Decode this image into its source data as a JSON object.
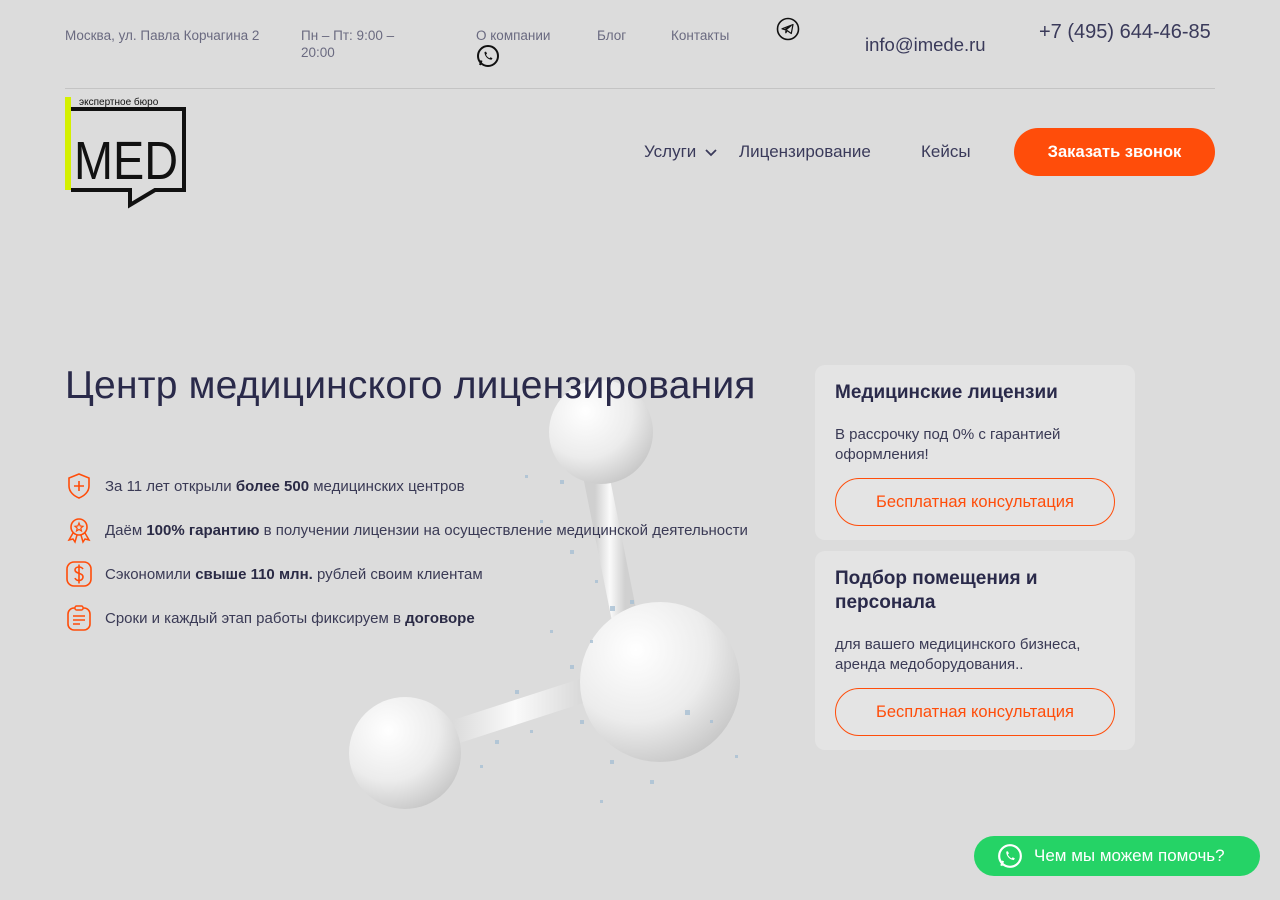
{
  "topbar": {
    "address": "Москва, ул. Павла Корчагина 2",
    "hours": "Пн – Пт: 9:00 – 20:00",
    "links": [
      "О компании",
      "Блог",
      "Контакты"
    ],
    "email": "info@imede.ru",
    "phone": "+7 (495) 644-46-85",
    "icons": [
      "whatsapp-icon",
      "telegram-icon"
    ]
  },
  "logo": {
    "tagline": "экспертное бюро",
    "name": "MED",
    "accent": "#d4f000"
  },
  "nav": {
    "services": "Услуги",
    "licensing": "Лицензирование",
    "cases": "Кейсы",
    "cta": "Заказать звонок"
  },
  "hero": {
    "title": "Центр медицинского лицензирования",
    "features": [
      {
        "pre": "За 11 лет открыли ",
        "bold": "более 500",
        "post": " медицинских центров",
        "icon": "shield-plus-icon"
      },
      {
        "pre": "Даём ",
        "bold": "100% гарантию",
        "post": " в получении лицензии на осуществление медицинской деятельности",
        "icon": "award-badge-icon"
      },
      {
        "pre": "Сэкономили ",
        "bold": "свыше 110 млн.",
        "post": " рублей своим клиентам",
        "icon": "dollar-icon"
      },
      {
        "pre": "Сроки и каждый этап работы фиксируем в ",
        "bold": "договоре",
        "post": "",
        "icon": "clipboard-icon"
      }
    ]
  },
  "cards": [
    {
      "title": "Медицинские лицензии",
      "text": "В рассрочку под 0% с гарантией оформления!",
      "button": "Бесплатная консультация"
    },
    {
      "title": "Подбор помещения и персонала",
      "text": "для вашего медицинского бизнеса, аренда медоборудования..",
      "button": "Бесплатная консультация"
    }
  ],
  "chat": {
    "label": "Чем мы можем помочь?"
  },
  "colors": {
    "accent": "#ff4d0a",
    "whatsapp": "#25d366",
    "text": "#2a2a4a",
    "background": "#dcdcdc"
  }
}
